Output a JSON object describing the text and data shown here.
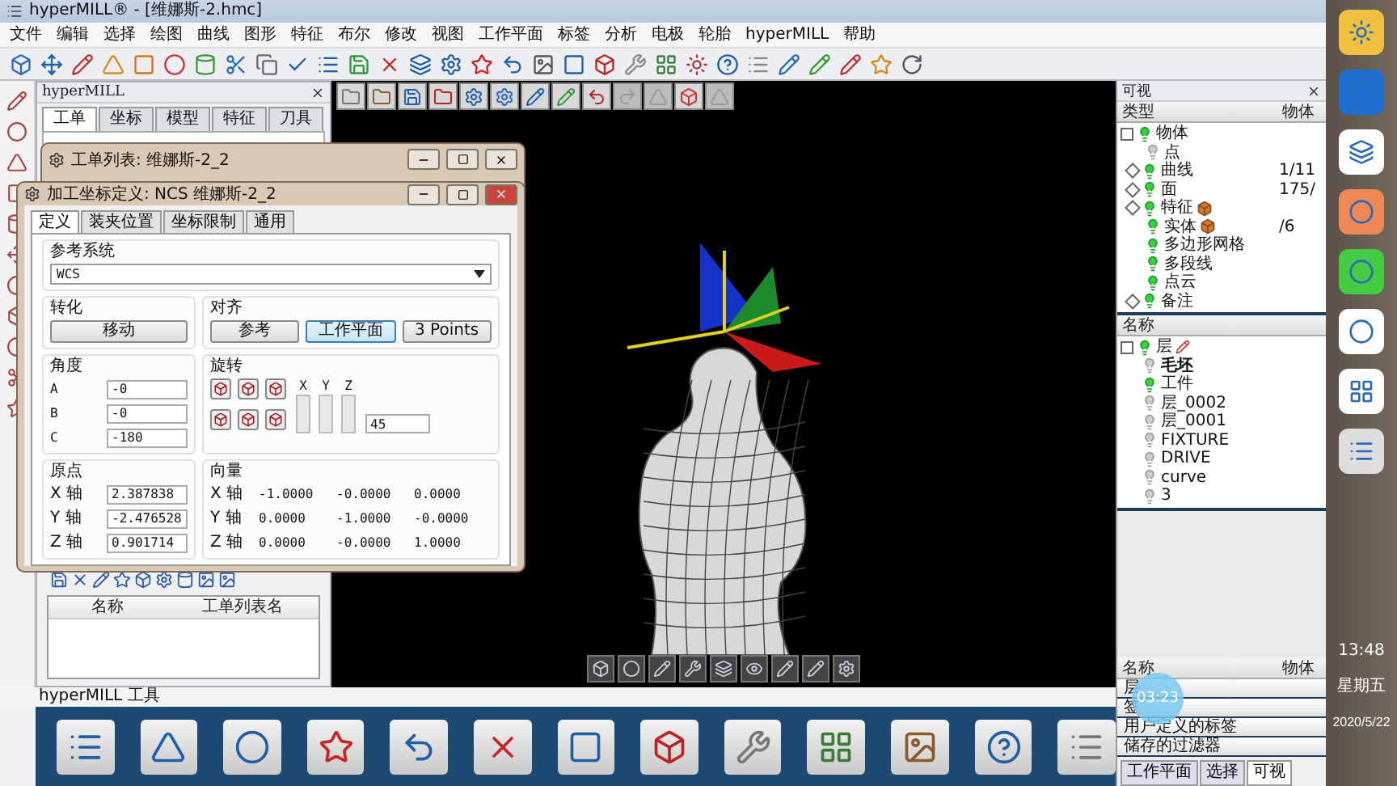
{
  "window": {
    "title": "hyperMILL® - [维娜斯-2.hmc]"
  },
  "menu": [
    "文件",
    "编辑",
    "选择",
    "绘图",
    "曲线",
    "图形",
    "特征",
    "布尔",
    "修改",
    "视图",
    "工作平面",
    "标签",
    "分析",
    "电极",
    "轮胎",
    "hyperMILL",
    "帮助"
  ],
  "left_panel": {
    "title": "hyperMILL",
    "tabs": [
      {
        "label": "工单",
        "selected": true
      },
      {
        "label": "坐标",
        "selected": false
      },
      {
        "label": "模型",
        "selected": false
      },
      {
        "label": "特征",
        "selected": false
      },
      {
        "label": "刀具",
        "selected": false
      }
    ],
    "table_columns": [
      "名称",
      "工单列表名"
    ]
  },
  "job_list_dialog": {
    "title": "工单列表: 维娜斯-2_2"
  },
  "coord_dialog": {
    "title": "加工坐标定义: NCS 维娜斯-2_2",
    "tabs": [
      {
        "label": "定义",
        "selected": true
      },
      {
        "label": "装夹位置",
        "selected": false
      },
      {
        "label": "坐标限制",
        "selected": false
      },
      {
        "label": "通用",
        "selected": false
      }
    ],
    "reference_system": {
      "label": "参考系统",
      "value": "WCS"
    },
    "transform": {
      "label": "转化",
      "button": "移动"
    },
    "align": {
      "label": "对齐",
      "buttons": [
        {
          "label": "参考",
          "selected": false
        },
        {
          "label": "工作平面",
          "selected": true
        },
        {
          "label": "3 Points",
          "selected": false
        }
      ]
    },
    "angles": {
      "label": "角度",
      "rows": [
        {
          "axis": "A",
          "value": "-0"
        },
        {
          "axis": "B",
          "value": "-0"
        },
        {
          "axis": "C",
          "value": "-180"
        }
      ]
    },
    "rotation": {
      "label": "旋转",
      "axes": [
        "X",
        "Y",
        "Z"
      ],
      "step": "45"
    },
    "origin": {
      "label": "原点",
      "rows": [
        {
          "axis": "X 轴",
          "value": "2.387838"
        },
        {
          "axis": "Y 轴",
          "value": "-2.476528"
        },
        {
          "axis": "Z 轴",
          "value": "0.901714"
        }
      ]
    },
    "vector": {
      "label": "向量",
      "rows": [
        {
          "axis": "X 轴",
          "values": [
            "-1.0000",
            "-0.0000",
            "0.0000"
          ]
        },
        {
          "axis": "Y 轴",
          "values": [
            "0.0000",
            "-1.0000",
            "-0.0000"
          ]
        },
        {
          "axis": "Z 轴",
          "values": [
            "0.0000",
            "-0.0000",
            "1.0000"
          ]
        }
      ]
    }
  },
  "visibility_panel": {
    "title": "可视",
    "columns": [
      "类型",
      "物体"
    ],
    "root": {
      "label": "物体",
      "on": true,
      "children": [
        {
          "label": "点",
          "on": false,
          "has_children": false,
          "solid": false
        },
        {
          "label": "曲线",
          "on": true,
          "has_children": true,
          "solid": false,
          "count": "1/11"
        },
        {
          "label": "面",
          "on": true,
          "has_children": true,
          "solid": false,
          "count": "175/"
        },
        {
          "label": "特征",
          "on": true,
          "has_children": true,
          "solid": true
        },
        {
          "label": "实体",
          "on": true,
          "has_children": false,
          "solid": true,
          "count": "/6"
        },
        {
          "label": "多边形网格",
          "on": true,
          "has_children": false,
          "solid": false
        },
        {
          "label": "多段线",
          "on": true,
          "has_children": false,
          "solid": false
        },
        {
          "label": "点云",
          "on": true,
          "has_children": false,
          "solid": false
        },
        {
          "label": "备注",
          "on": true,
          "has_children": true,
          "solid": false
        }
      ]
    },
    "layers_header": "名称",
    "layers": {
      "label": "层",
      "on": true,
      "children": [
        {
          "label": "毛坯",
          "on": false,
          "bold": true
        },
        {
          "label": "工件",
          "on": true,
          "bold": false
        },
        {
          "label": "层_0002",
          "on": false,
          "bold": false
        },
        {
          "label": "层_0001",
          "on": false,
          "bold": false
        },
        {
          "label": "FIXTURE",
          "on": false,
          "bold": false
        },
        {
          "label": "DRIVE",
          "on": false,
          "bold": false
        },
        {
          "label": "curve",
          "on": false,
          "bold": false
        },
        {
          "label": "3",
          "on": false,
          "bold": false
        }
      ]
    }
  },
  "tags_panel": {
    "columns": [
      "名称",
      "物体"
    ],
    "rows": [
      "层",
      "签",
      "用户定义的标签",
      "储存的过滤器"
    ],
    "tabs": [
      {
        "label": "工作平面",
        "selected": false
      },
      {
        "label": "选择",
        "selected": false
      },
      {
        "label": "可视",
        "selected": true
      }
    ]
  },
  "tools_bar": {
    "title": "hyperMILL 工具"
  },
  "recording_time": "03:23",
  "taskbar": {
    "time": "13:48",
    "day": "星期五",
    "date": "2020/5/22"
  }
}
